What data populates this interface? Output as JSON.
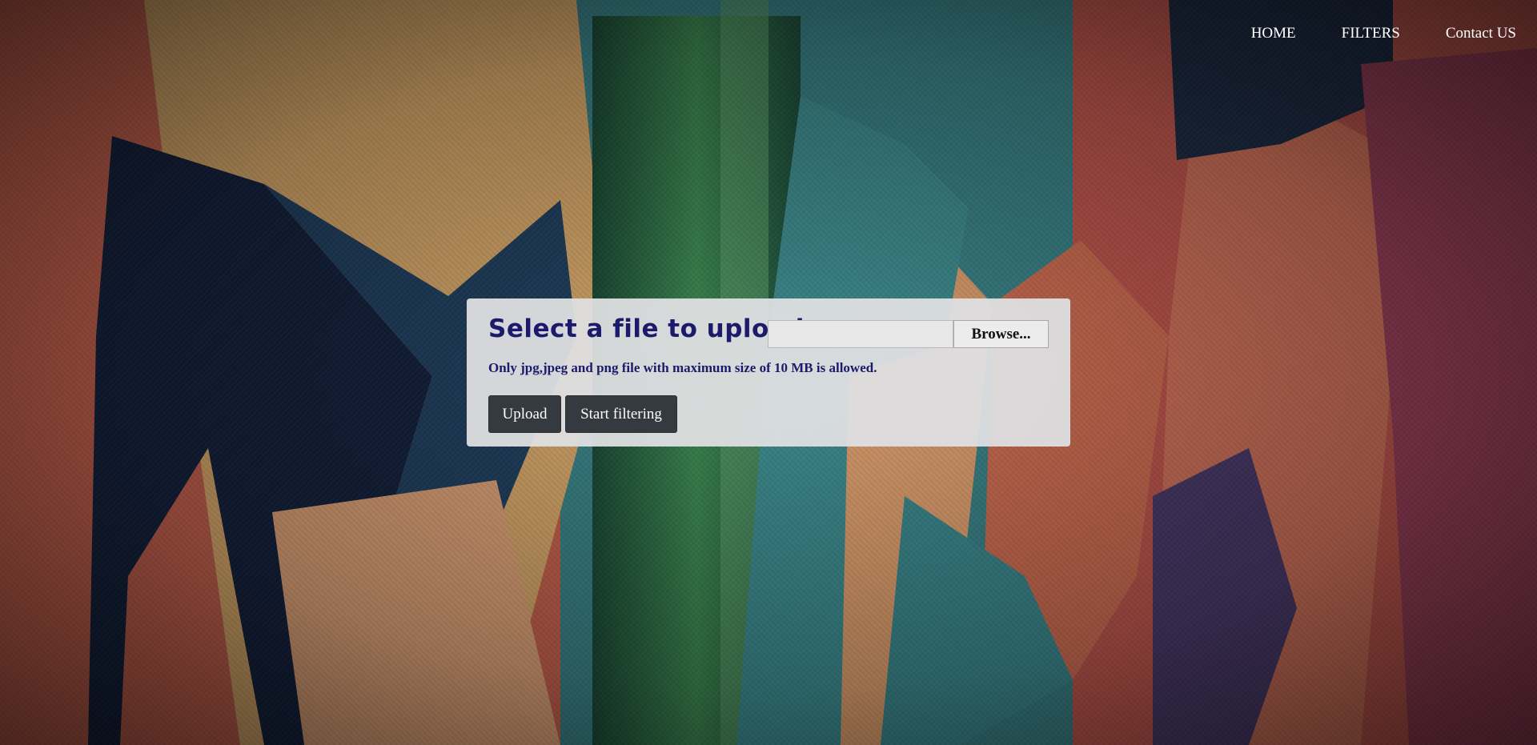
{
  "nav": {
    "items": [
      {
        "label": "HOME"
      },
      {
        "label": "FILTERS"
      },
      {
        "label": "Contact US"
      }
    ]
  },
  "upload": {
    "title": "Select a file to upload",
    "file_value": "",
    "browse_label": "Browse...",
    "hint": "Only jpg,jpeg and png file with maximum size of 10 MB is allowed.",
    "upload_label": "Upload",
    "start_filtering_label": "Start filtering"
  },
  "colors": {
    "panel_bg": "#dedfe2",
    "heading_text": "#1c1a6b",
    "button_dark": "#343a40",
    "nav_text": "#ffffff"
  },
  "background": {
    "description_icon": "abstract-painted-m-artwork"
  }
}
